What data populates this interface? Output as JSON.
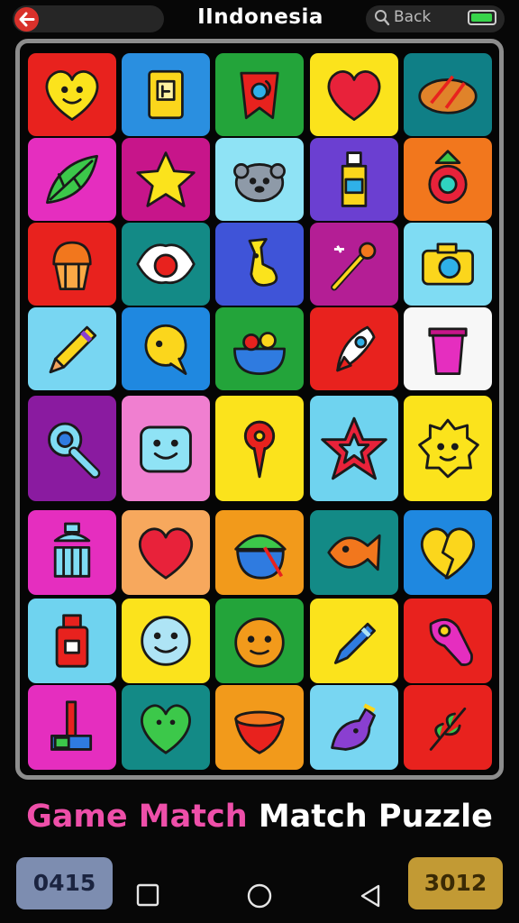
{
  "app": {
    "title": "IIndonesia",
    "search_label": "Back",
    "battery_level": 0.95
  },
  "caption": {
    "part1": "Game Match",
    "part2": "Match Puzzle"
  },
  "scores": {
    "left": "0415",
    "right": "3012"
  },
  "icons": {
    "back": "back-arrow-icon",
    "search": "search-icon",
    "battery": "battery-icon",
    "nav": [
      "recent-apps-icon",
      "home-icon",
      "back-triangle-icon"
    ]
  },
  "board": {
    "tiles": [
      [
        {
          "color": "#e8221e",
          "icon": "heart-face"
        },
        {
          "color": "#2a8fe0",
          "icon": "card"
        },
        {
          "color": "#23a43a",
          "icon": "ribbon"
        },
        {
          "color": "#fbe31c",
          "icon": "heart"
        },
        {
          "color": "#0f7f86",
          "icon": "bread"
        }
      ],
      [
        {
          "color": "#e52ebf",
          "icon": "leaf"
        },
        {
          "color": "#c7158a",
          "icon": "star"
        },
        {
          "color": "#8fe3f5",
          "icon": "creature"
        },
        {
          "color": "#6b3fd1",
          "icon": "bottle"
        },
        {
          "color": "#f2771d",
          "icon": "strawberry"
        }
      ],
      [
        {
          "color": "#e8221e",
          "icon": "cupcake"
        },
        {
          "color": "#138a86",
          "icon": "eye"
        },
        {
          "color": "#3f54d8",
          "icon": "giraffe"
        },
        {
          "color": "#b41e95",
          "icon": "wand"
        },
        {
          "color": "#7fdcf3",
          "icon": "camera"
        }
      ],
      [
        {
          "color": "#78d6f2",
          "icon": "pencil"
        },
        {
          "color": "#1f88e0",
          "icon": "chat"
        },
        {
          "color": "#23a43a",
          "icon": "bowl"
        },
        {
          "color": "#e8221e",
          "icon": "rocket"
        },
        {
          "color": "#f7f7f7",
          "icon": "cup"
        }
      ],
      [
        {
          "color": "#8a1ba0",
          "icon": "rattle"
        },
        {
          "color": "#f07fd0",
          "icon": "box-face"
        },
        {
          "color": "#fbe31c",
          "icon": "pin"
        },
        {
          "color": "#6fd3ef",
          "icon": "star-outline"
        },
        {
          "color": "#fbe31c",
          "icon": "sun-face"
        }
      ],
      [
        {
          "color": "#e52ebf",
          "icon": "bottle-cap"
        },
        {
          "color": "#f7a85d",
          "icon": "heart"
        },
        {
          "color": "#f29a1b",
          "icon": "acorn"
        },
        {
          "color": "#138a86",
          "icon": "fish"
        },
        {
          "color": "#1f88e0",
          "icon": "broken-heart"
        }
      ],
      [
        {
          "color": "#6fd3ef",
          "icon": "jar"
        },
        {
          "color": "#fbe31c",
          "icon": "smiley"
        },
        {
          "color": "#23a43a",
          "icon": "orange-face"
        },
        {
          "color": "#fbe31c",
          "icon": "marker"
        },
        {
          "color": "#e8221e",
          "icon": "tongue"
        }
      ],
      [
        {
          "color": "#e52ebf",
          "icon": "pipe"
        },
        {
          "color": "#138a86",
          "icon": "heart-splat"
        },
        {
          "color": "#f29a1b",
          "icon": "bowl-face"
        },
        {
          "color": "#78d6f2",
          "icon": "bird"
        },
        {
          "color": "#e8221e",
          "icon": "sprig"
        }
      ]
    ]
  }
}
